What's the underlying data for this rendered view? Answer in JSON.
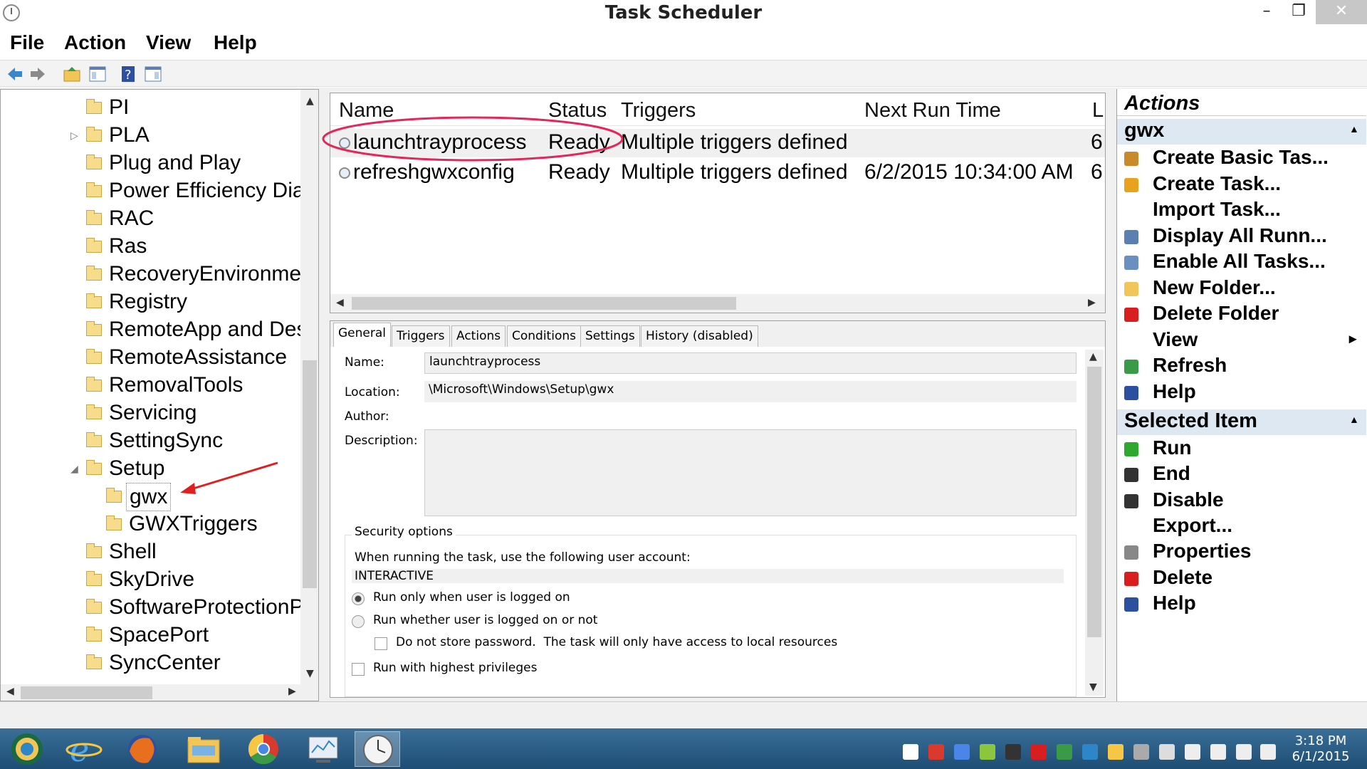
{
  "window": {
    "title": "Task Scheduler",
    "min": "–",
    "max": "❐",
    "close": "✕"
  },
  "menu": [
    "File",
    "Action",
    "View",
    "Help"
  ],
  "tree": {
    "items": [
      {
        "label": "PI",
        "indent": 1,
        "expander": ""
      },
      {
        "label": "PLA",
        "indent": 1,
        "expander": "▷"
      },
      {
        "label": "Plug and Play",
        "indent": 1,
        "expander": ""
      },
      {
        "label": "Power Efficiency Dia",
        "indent": 1,
        "expander": ""
      },
      {
        "label": "RAC",
        "indent": 1,
        "expander": ""
      },
      {
        "label": "Ras",
        "indent": 1,
        "expander": ""
      },
      {
        "label": "RecoveryEnvironmer",
        "indent": 1,
        "expander": ""
      },
      {
        "label": "Registry",
        "indent": 1,
        "expander": ""
      },
      {
        "label": "RemoteApp and Des",
        "indent": 1,
        "expander": ""
      },
      {
        "label": "RemoteAssistance",
        "indent": 1,
        "expander": ""
      },
      {
        "label": "RemovalTools",
        "indent": 1,
        "expander": ""
      },
      {
        "label": "Servicing",
        "indent": 1,
        "expander": ""
      },
      {
        "label": "SettingSync",
        "indent": 1,
        "expander": ""
      },
      {
        "label": "Setup",
        "indent": 1,
        "expander": "◢"
      },
      {
        "label": "gwx",
        "indent": 2,
        "expander": ""
      },
      {
        "label": "GWXTriggers",
        "indent": 2,
        "expander": ""
      },
      {
        "label": "Shell",
        "indent": 1,
        "expander": ""
      },
      {
        "label": "SkyDrive",
        "indent": 1,
        "expander": ""
      },
      {
        "label": "SoftwareProtectionP",
        "indent": 1,
        "expander": ""
      },
      {
        "label": "SpacePort",
        "indent": 1,
        "expander": ""
      },
      {
        "label": "SyncCenter",
        "indent": 1,
        "expander": ""
      }
    ]
  },
  "tasks": {
    "columns": [
      "Name",
      "Status",
      "Triggers",
      "Next Run Time",
      "L"
    ],
    "rows": [
      {
        "name": "launchtrayprocess",
        "status": "Ready",
        "triggers": "Multiple triggers defined",
        "next": "",
        "last": "6"
      },
      {
        "name": "refreshgwxconfig",
        "status": "Ready",
        "triggers": "Multiple triggers defined",
        "next": "6/2/2015 10:34:00 AM",
        "last": "6"
      }
    ]
  },
  "details": {
    "tabs": [
      "General",
      "Triggers",
      "Actions",
      "Conditions",
      "Settings",
      "History (disabled)"
    ],
    "name_label": "Name:",
    "name_value": "launchtrayprocess",
    "location_label": "Location:",
    "location_value": "\\Microsoft\\Windows\\Setup\\gwx",
    "author_label": "Author:",
    "description_label": "Description:",
    "security_title": "Security options",
    "security_prompt": "When running the task, use the following user account:",
    "account": "INTERACTIVE",
    "opt_logged_on": "Run only when user is logged on",
    "opt_whether": "Run whether user is logged on or not",
    "opt_no_store": "Do not store password.  The task will only have access to local resources",
    "opt_highest": "Run with highest privileges"
  },
  "actions": {
    "title": "Actions",
    "section1": "gwx",
    "items1": [
      {
        "label": "Create Basic Tas...",
        "icon": "create-basic-task-icon",
        "color": "#c98a2b"
      },
      {
        "label": "Create Task...",
        "icon": "create-task-icon",
        "color": "#e8a21e"
      },
      {
        "label": "Import Task...",
        "icon": "",
        "color": ""
      },
      {
        "label": "Display All Runn...",
        "icon": "display-running-icon",
        "color": "#5b7fb0"
      },
      {
        "label": "Enable All Tasks...",
        "icon": "enable-all-icon",
        "color": "#6a8fc0"
      },
      {
        "label": "New Folder...",
        "icon": "new-folder-icon",
        "color": "#f2c558"
      },
      {
        "label": "Delete Folder",
        "icon": "delete-folder-icon",
        "color": "#d81e1e"
      },
      {
        "label": "View",
        "icon": "",
        "color": "",
        "submenu": "▸"
      },
      {
        "label": "Refresh",
        "icon": "refresh-icon",
        "color": "#3a9a48"
      },
      {
        "label": "Help",
        "icon": "help-icon",
        "color": "#2d4fa0"
      }
    ],
    "section2": "Selected Item",
    "items2": [
      {
        "label": "Run",
        "icon": "run-icon",
        "color": "#2ea82e"
      },
      {
        "label": "End",
        "icon": "end-icon",
        "color": "#333333"
      },
      {
        "label": "Disable",
        "icon": "disable-icon",
        "color": "#333333"
      },
      {
        "label": "Export...",
        "icon": "",
        "color": ""
      },
      {
        "label": "Properties",
        "icon": "properties-icon",
        "color": "#888888"
      },
      {
        "label": "Delete",
        "icon": "delete-icon",
        "color": "#d81e1e"
      },
      {
        "label": "Help",
        "icon": "help-icon",
        "color": "#2d4fa0"
      }
    ]
  },
  "taskbar": {
    "time": "3:18 PM",
    "date": "6/1/2015",
    "apps": [
      "start-orb-icon",
      "internet-explorer-icon",
      "firefox-icon",
      "file-explorer-icon",
      "chrome-icon",
      "performance-monitor-icon",
      "task-scheduler-icon"
    ]
  },
  "colors": {
    "highlight_circle": "#e0285a",
    "arrow": "#e02020",
    "section_header_bg": "#dde8f3"
  }
}
